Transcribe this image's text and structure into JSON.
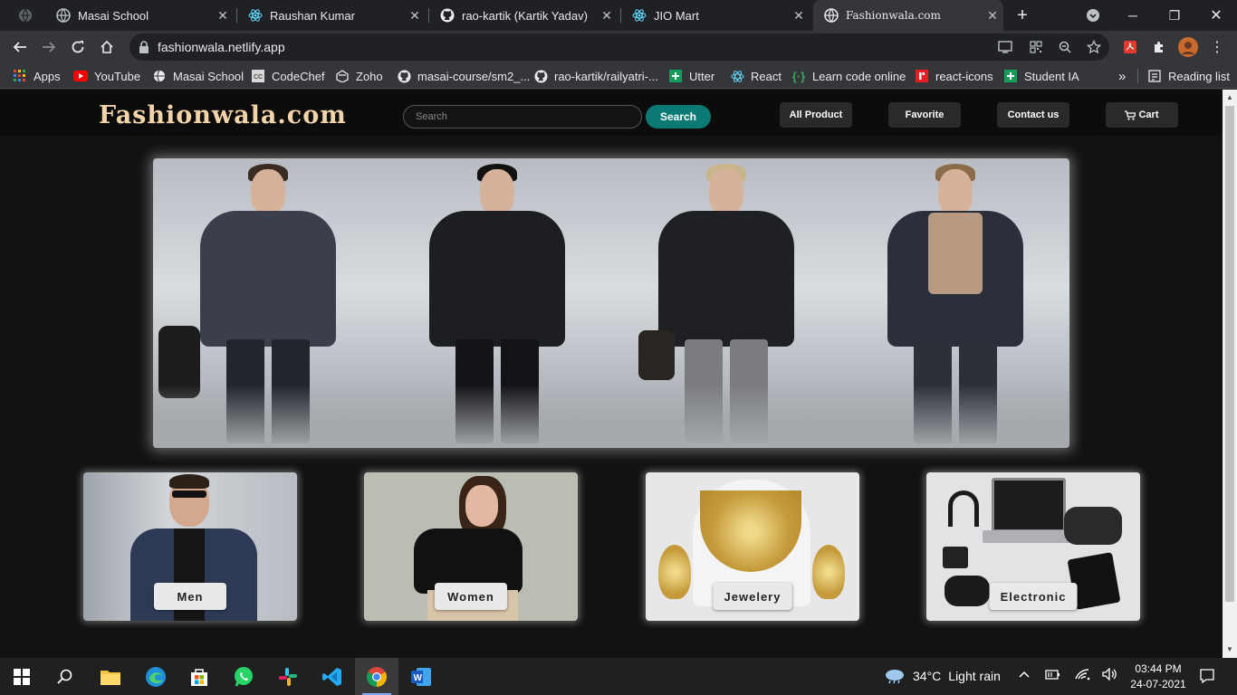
{
  "browser": {
    "tabs": [
      {
        "title": "Masai School"
      },
      {
        "title": "Raushan Kumar"
      },
      {
        "title": "rao-kartik (Kartik Yadav)"
      },
      {
        "title": "JIO Mart"
      },
      {
        "title": "Fashionwala.com"
      }
    ],
    "url": "fashionwala.netlify.app",
    "bookmarks": [
      {
        "label": "Apps"
      },
      {
        "label": "YouTube"
      },
      {
        "label": "Masai School"
      },
      {
        "label": "CodeChef"
      },
      {
        "label": "Zoho"
      },
      {
        "label": "masai-course/sm2_..."
      },
      {
        "label": "rao-kartik/railyatri-..."
      },
      {
        "label": "Utter"
      },
      {
        "label": "React"
      },
      {
        "label": "Learn code online"
      },
      {
        "label": "react-icons"
      },
      {
        "label": "Student IA"
      }
    ],
    "overflow": "»",
    "reading_list": "Reading list"
  },
  "site": {
    "brand": "Fashionwala.com",
    "search_placeholder": "Search",
    "search_button": "Search",
    "nav": [
      {
        "label": "All Product"
      },
      {
        "label": "Favorite"
      },
      {
        "label": "Contact us"
      },
      {
        "label": "Cart"
      }
    ],
    "categories": [
      {
        "label": "Men"
      },
      {
        "label": "Women"
      },
      {
        "label": "Jewelery"
      },
      {
        "label": "Electronic"
      }
    ]
  },
  "taskbar": {
    "weather_temp": "34°C",
    "weather_text": "Light rain",
    "time": "03:44 PM",
    "date": "24-07-2021"
  }
}
